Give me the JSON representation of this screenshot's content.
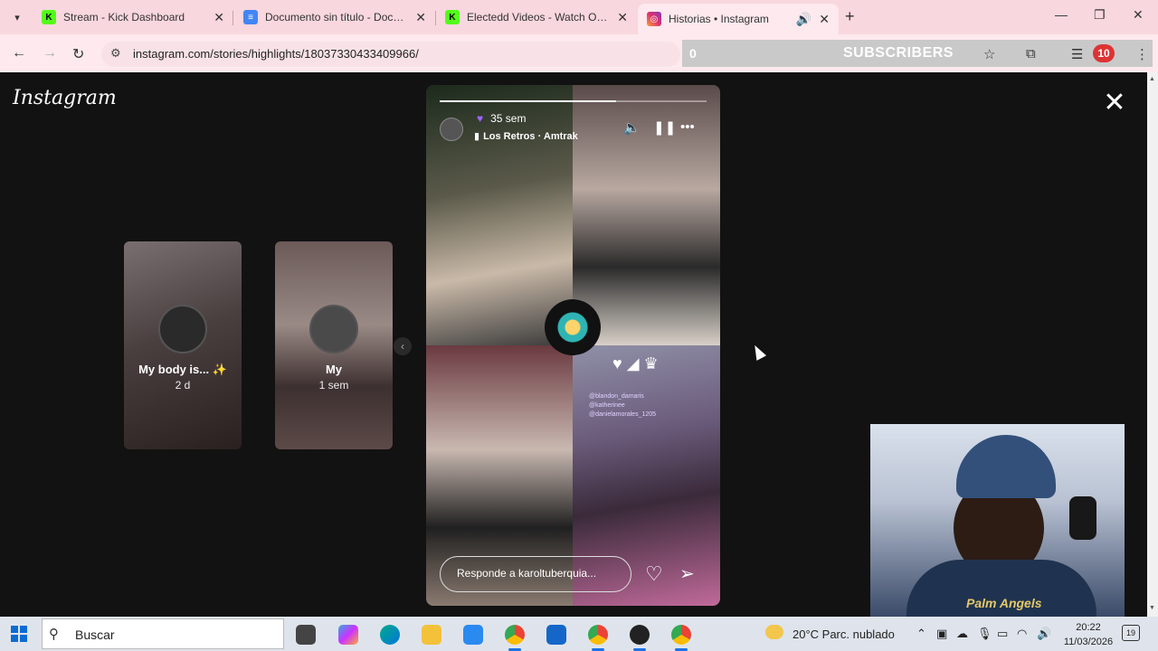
{
  "browser": {
    "tabs": [
      {
        "title": "Stream - Kick Dashboard",
        "favicon": "kick-icon",
        "color": "#53fc18",
        "active": false
      },
      {
        "title": "Documento sin título - Docume",
        "favicon": "docs-icon",
        "color": "#4285f4",
        "active": false
      },
      {
        "title": "Electedd Videos - Watch On-De",
        "favicon": "kick-icon",
        "color": "#53fc18",
        "active": false
      },
      {
        "title": "Historias • Instagram",
        "favicon": "instagram-icon",
        "color": "#e1306c",
        "active": true
      }
    ],
    "url": "instagram.com/stories/highlights/18037330433409966/",
    "subscribers_count": "0",
    "subscribers_label": "SUBSCRIBERS",
    "extension_badge": "10"
  },
  "instagram": {
    "logo": "Instagram",
    "previews": [
      {
        "name": "My body is...",
        "age": "2 d",
        "emoji": "✨"
      },
      {
        "name": "My",
        "age": "1 sem"
      }
    ],
    "story": {
      "time": "35 sem",
      "song": "Los Retros · Amtrak",
      "progress": 0.66,
      "sticker_lines": [
        "@blandon_damaris",
        "@katherinee",
        "@danielamorales_1205"
      ],
      "reply_placeholder": "Responde a karoltuberquia..."
    }
  },
  "webcam": {
    "shirt_text": "Palm Angels"
  },
  "taskbar": {
    "search_placeholder": "Buscar",
    "weather": "20°C  Parc. nublado",
    "time": "20:22",
    "date": "11/03/2026",
    "notification_count": "19"
  }
}
